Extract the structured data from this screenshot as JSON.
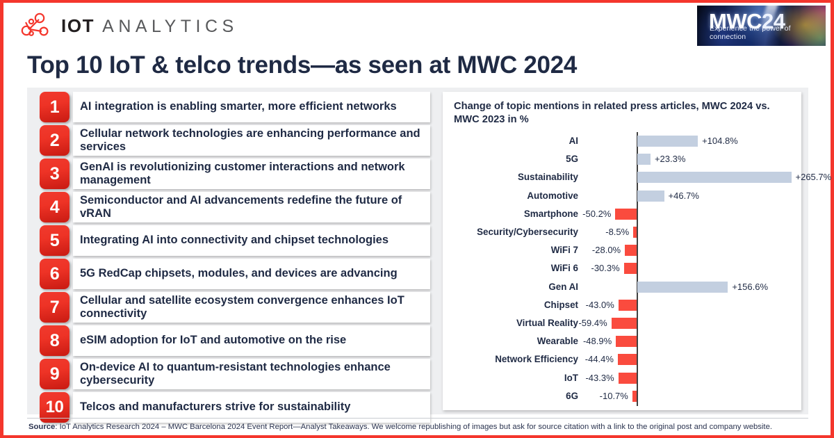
{
  "brand": {
    "logo_icon": "network-nodes-icon",
    "name_primary": "IOT",
    "name_secondary": "ANALYTICS",
    "logo_color": "#f4362c"
  },
  "event_badge": {
    "title_letters": "MWC",
    "title_number": "24",
    "tagline": "Experience the power of connection"
  },
  "title": "Top 10 IoT & telco trends—as seen at MWC 2024",
  "trends": [
    {
      "rank": "1",
      "text": "AI integration is enabling smarter, more efficient networks"
    },
    {
      "rank": "2",
      "text": "Cellular network technologies are enhancing performance and services"
    },
    {
      "rank": "3",
      "text": "GenAI is revolutionizing customer interactions and network management"
    },
    {
      "rank": "4",
      "text": "Semiconductor and AI advancements redefine the future of vRAN"
    },
    {
      "rank": "5",
      "text": "Integrating AI into connectivity and chipset technologies"
    },
    {
      "rank": "6",
      "text": "5G RedCap chipsets, modules, and devices are advancing"
    },
    {
      "rank": "7",
      "text": "Cellular and satellite ecosystem convergence enhances IoT connectivity"
    },
    {
      "rank": "8",
      "text": "eSIM adoption for IoT and automotive on the rise"
    },
    {
      "rank": "9",
      "text": "On-device AI to quantum-resistant technologies enhance cybersecurity"
    },
    {
      "rank": "10",
      "text": "Telcos and manufacturers strive for sustainability"
    }
  ],
  "chart_data": {
    "type": "bar",
    "orientation": "horizontal",
    "title": "Change of topic mentions in related press articles, MWC 2024 vs. MWC 2023 in %",
    "xlabel": "",
    "ylabel": "",
    "grid": false,
    "legend": "none",
    "xlim": [
      -60,
      266
    ],
    "positive_color": "#c3cfe0",
    "negative_color": "#fa4b3e",
    "categories": [
      "AI",
      "5G",
      "Sustainability",
      "Automotive",
      "Smartphone",
      "Security/Cybersecurity",
      "WiFi 7",
      "WiFi 6",
      "Gen AI",
      "Chipset",
      "Virtual Reality",
      "Wearable",
      "Network Efficiency",
      "IoT",
      "6G"
    ],
    "values": [
      104.8,
      23.3,
      265.7,
      46.7,
      -50.2,
      -8.5,
      -28.0,
      -30.3,
      156.6,
      -43.0,
      -59.4,
      -48.9,
      -44.4,
      -43.3,
      -10.7
    ],
    "labels": [
      "+104.8%",
      "+23.3%",
      "+265.7%",
      "+46.7%",
      "-50.2%",
      "-8.5%",
      "-28.0%",
      "-30.3%",
      "+156.6%",
      "-43.0%",
      "-59.4%",
      "-48.9%",
      "-44.4%",
      "-43.3%",
      "-10.7%"
    ]
  },
  "footer": {
    "label": "Source",
    "text": ": IoT Analytics Research 2024 – MWC Barcelona 2024 Event Report—Analyst Takeaways. We welcome republishing of images but ask for source citation with a link to the original post and company website."
  }
}
